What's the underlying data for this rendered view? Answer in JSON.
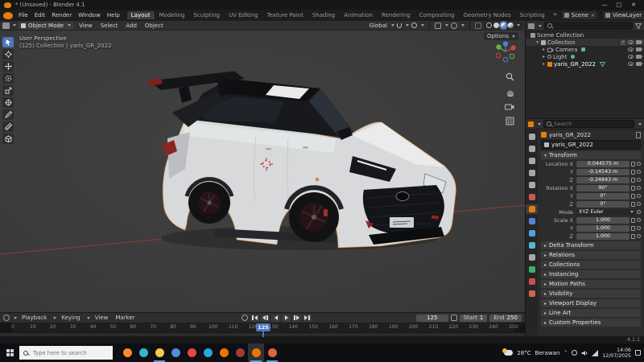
{
  "window": {
    "title": "* (Unsaved) - Blender 4.1",
    "minimize": "—",
    "maximize": "□",
    "close": "✕"
  },
  "topbar": {
    "menus": [
      "File",
      "Edit",
      "Render",
      "Window",
      "Help"
    ],
    "workspaces": [
      "Layout",
      "Modeling",
      "Sculpting",
      "UV Editing",
      "Texture Paint",
      "Shading",
      "Animation",
      "Rendering",
      "Compositing",
      "Geometry Nodes",
      "Scripting"
    ],
    "active_workspace": "Layout",
    "add_workspace_label": "+",
    "scene_label": "Scene",
    "viewlayer_label": "ViewLayer"
  },
  "viewport": {
    "mode": "Object Mode",
    "menus": [
      "View",
      "Select",
      "Add",
      "Object"
    ],
    "orientation": "Global",
    "options_label": "Options",
    "overlay_line1": "User Perspective",
    "overlay_line2": "(125) Collection | yaris_GR_2022"
  },
  "outliner": {
    "root_label": "Scene Collection",
    "rows": [
      {
        "label": "Collection"
      },
      {
        "label": "Camera"
      },
      {
        "label": "Light"
      },
      {
        "label": "yaris_GR_2022"
      }
    ]
  },
  "properties": {
    "search_placeholder": "Search",
    "breadcrumb_object": "yaris_GR_2022",
    "object_name": "yaris_GR_2022",
    "transform_title": "Transform",
    "transform_rows": [
      {
        "label": "Location X",
        "value": "0.044575 m"
      },
      {
        "label": "Y",
        "value": "-0.14543 m"
      },
      {
        "label": "Z",
        "value": "-0.24843 m"
      },
      {
        "label": "Rotation X",
        "value": "90°"
      },
      {
        "label": "Y",
        "value": "0°"
      },
      {
        "label": "Z",
        "value": "0°"
      },
      {
        "label": "Mode",
        "value": "XYZ Euler"
      },
      {
        "label": "Scale X",
        "value": "1.000"
      },
      {
        "label": "Y",
        "value": "1.000"
      },
      {
        "label": "Z",
        "value": "1.000"
      }
    ],
    "sections": [
      "Delta Transform",
      "Relations",
      "Collections",
      "Instancing",
      "Motion Paths",
      "Visibility",
      "Viewport Display",
      "Line Art",
      "Custom Properties"
    ],
    "tabs": [
      {
        "name": "tool",
        "color": "#a8a8a8"
      },
      {
        "name": "render",
        "color": "#a8a8a8"
      },
      {
        "name": "output",
        "color": "#a8a8a8"
      },
      {
        "name": "view-layer",
        "color": "#a8a8a8"
      },
      {
        "name": "scene",
        "color": "#a8a8a8"
      },
      {
        "name": "world",
        "color": "#c45a52"
      },
      {
        "name": "object",
        "color": "#e87d0d"
      },
      {
        "name": "modifiers",
        "color": "#5a7fd8"
      },
      {
        "name": "particles",
        "color": "#5a9fd8"
      },
      {
        "name": "physics",
        "color": "#5ab4d8"
      },
      {
        "name": "constraints",
        "color": "#a8a8a8"
      },
      {
        "name": "data",
        "color": "#3fae6a"
      },
      {
        "name": "material",
        "color": "#c94f4f"
      },
      {
        "name": "texture",
        "color": "#c96a4f"
      }
    ],
    "active_tab": "object"
  },
  "timeline": {
    "menus": [
      "Playback",
      "Keying",
      "View",
      "Marker"
    ],
    "ticks": [
      0,
      10,
      20,
      30,
      40,
      50,
      60,
      70,
      80,
      90,
      100,
      110,
      120,
      130,
      140,
      150,
      160,
      170,
      180,
      190,
      200,
      210,
      220,
      230,
      240,
      250
    ],
    "current_frame": 125,
    "frame_field": "125",
    "start_label": "Start",
    "start_value": "1",
    "end_label": "End",
    "end_value": "250"
  },
  "statusbar": {
    "version": "4.1.1"
  },
  "taskbar": {
    "search_placeholder": "Type here to search",
    "apps": [
      {
        "name": "firefox",
        "color": "#ff8a2a",
        "running": false,
        "active": false
      },
      {
        "name": "edge",
        "color": "#38b6c9",
        "running": false,
        "active": false
      },
      {
        "name": "file-explorer",
        "color": "#f6c84c",
        "running": true,
        "active": false
      },
      {
        "name": "microsoft-store",
        "color": "#4f8fd9",
        "running": false,
        "active": false
      },
      {
        "name": "chrome",
        "color": "#e8483f",
        "running": false,
        "active": false
      },
      {
        "name": "telegram",
        "color": "#2ca5e0",
        "running": false,
        "active": false
      },
      {
        "name": "blender",
        "color": "#ea7600",
        "running": false,
        "active": false
      },
      {
        "name": "media-app",
        "color": "#a23b3b",
        "running": false,
        "active": false
      },
      {
        "name": "blender-active",
        "color": "#ea7600",
        "running": true,
        "active": true
      },
      {
        "name": "brave",
        "color": "#e2643c",
        "running": true,
        "active": false
      }
    ],
    "tray": {
      "temp": "28°C",
      "weather": "Berawan",
      "time": "14:06",
      "date": "12/07/2025"
    }
  },
  "colors": {
    "accent": "#4772b3",
    "selection_orange": "#e87d0d",
    "axis_x": "#9f3a33"
  }
}
